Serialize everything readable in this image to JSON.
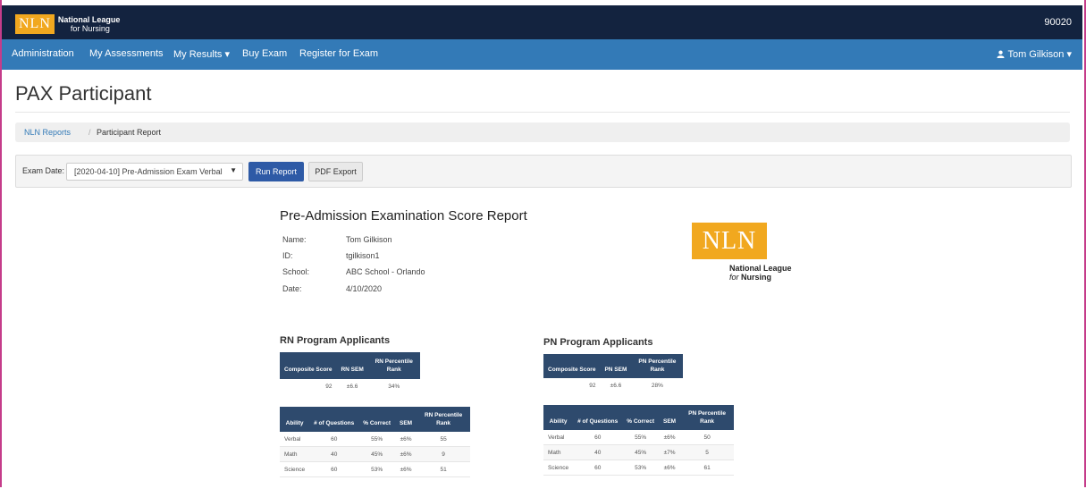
{
  "header": {
    "logo_mark": "NLN",
    "logo_line1": "National League",
    "logo_line2": "for Nursing",
    "account_number": "90020"
  },
  "nav": {
    "items": [
      "Administration",
      "My Assessments",
      "My Results ▾",
      "Buy Exam",
      "Register for Exam"
    ],
    "user": "Tom Gilkison ▾"
  },
  "page": {
    "title": "PAX Participant"
  },
  "breadcrumb": {
    "link": "NLN Reports",
    "separator": "/",
    "current": "Participant Report"
  },
  "filter": {
    "label": "Exam Date:",
    "selected": "[2020-04-10] Pre-Admission Exam Verbal",
    "run_label": "Run Report",
    "pdf_label": "PDF Export"
  },
  "report": {
    "title": "Pre-Admission Examination Score Report",
    "info": [
      {
        "label": "Name:",
        "value": "Tom Gilkison"
      },
      {
        "label": "ID:",
        "value": "tgilkison1"
      },
      {
        "label": "School:",
        "value": "ABC School - Orlando"
      },
      {
        "label": "Date:",
        "value": "4/10/2020"
      }
    ],
    "logo_mark": "NLN",
    "logo_line1": "National League",
    "logo_line2_a": "for ",
    "logo_line2_b": "Nursing"
  },
  "rn": {
    "title": "RN Program Applicants",
    "summary_headers": [
      "Composite Score",
      "RN SEM",
      "RN Percentile Rank"
    ],
    "summary_row": [
      "92",
      "±6.6",
      "34%"
    ],
    "ability_headers": [
      "Ability",
      "# of Questions",
      "% Correct",
      "SEM",
      "RN Percentile Rank"
    ],
    "ability_rows": [
      [
        "Verbal",
        "60",
        "55%",
        "±6%",
        "55"
      ],
      [
        "Math",
        "40",
        "45%",
        "±6%",
        "9"
      ],
      [
        "Science",
        "60",
        "53%",
        "±6%",
        "51"
      ]
    ]
  },
  "pn": {
    "title": "PN Program Applicants",
    "summary_headers": [
      "Composite Score",
      "PN SEM",
      "PN Percentile Rank"
    ],
    "summary_row": [
      "92",
      "±6.6",
      "28%"
    ],
    "ability_headers": [
      "Ability",
      "# of Questions",
      "% Correct",
      "SEM",
      "PN Percentile Rank"
    ],
    "ability_rows": [
      [
        "Verbal",
        "60",
        "55%",
        "±6%",
        "50"
      ],
      [
        "Math",
        "40",
        "45%",
        "±7%",
        "5"
      ],
      [
        "Science",
        "60",
        "53%",
        "±6%",
        "61"
      ]
    ]
  }
}
